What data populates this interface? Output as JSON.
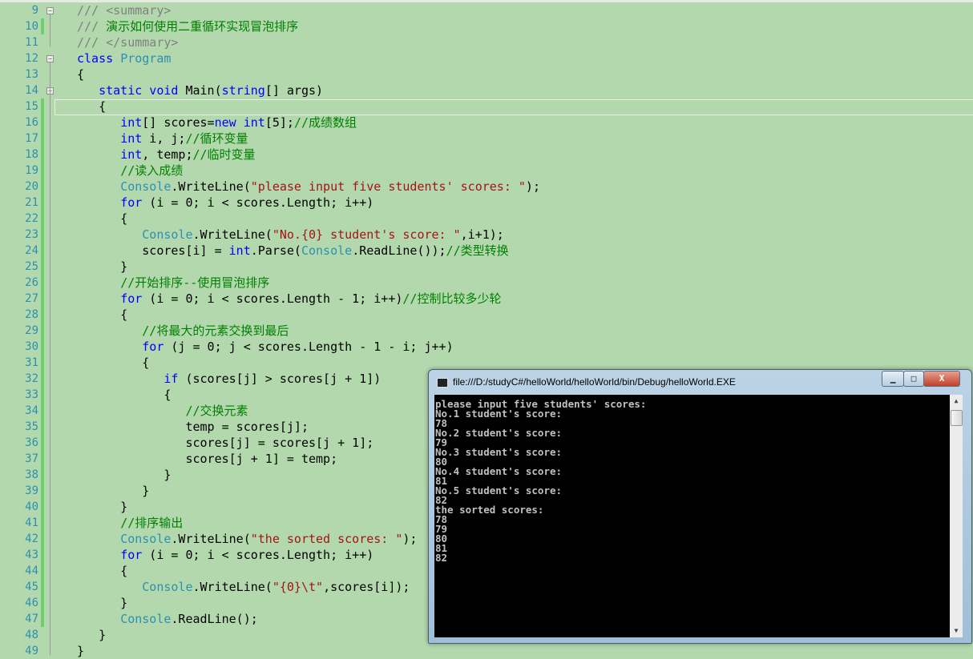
{
  "editor": {
    "lines": [
      {
        "n": "9",
        "t": [
          [
            "dc",
            "/// <summary>"
          ]
        ]
      },
      {
        "n": "10",
        "t": [
          [
            "dc",
            "/// "
          ],
          [
            "cm",
            "演示如何使用二重循环实现冒泡排序"
          ]
        ]
      },
      {
        "n": "11",
        "t": [
          [
            "dc",
            "/// </summary>"
          ]
        ]
      },
      {
        "n": "12",
        "t": [
          [
            "kw",
            "class "
          ],
          [
            "ty",
            "Program"
          ]
        ]
      },
      {
        "n": "13",
        "t": [
          [
            "",
            "{"
          ]
        ]
      },
      {
        "n": "14",
        "t": [
          [
            "",
            "   "
          ],
          [
            "kw",
            "static void "
          ],
          [
            "",
            "Main("
          ],
          [
            "kw",
            "string"
          ],
          [
            "",
            "[] args)"
          ]
        ]
      },
      {
        "n": "15",
        "t": [
          [
            "",
            "   {"
          ]
        ]
      },
      {
        "n": "16",
        "t": [
          [
            "",
            "      "
          ],
          [
            "kw",
            "int"
          ],
          [
            "",
            "[] scores="
          ],
          [
            "kw",
            "new int"
          ],
          [
            "",
            "[5];"
          ],
          [
            "cm",
            "//成绩数组"
          ]
        ]
      },
      {
        "n": "17",
        "t": [
          [
            "",
            "      "
          ],
          [
            "kw",
            "int"
          ],
          [
            "",
            " i, j;"
          ],
          [
            "cm",
            "//循环变量"
          ]
        ]
      },
      {
        "n": "18",
        "t": [
          [
            "",
            "      "
          ],
          [
            "kw",
            "int"
          ],
          [
            "",
            ", temp;"
          ],
          [
            "cm",
            "//临时变量"
          ]
        ]
      },
      {
        "n": "19",
        "t": [
          [
            "",
            "      "
          ],
          [
            "cm",
            "//读入成绩"
          ]
        ]
      },
      {
        "n": "20",
        "t": [
          [
            "",
            "      "
          ],
          [
            "ty",
            "Console"
          ],
          [
            "",
            ".WriteLine("
          ],
          [
            "st",
            "\"please input five students' scores: \""
          ],
          [
            "",
            ");"
          ]
        ]
      },
      {
        "n": "21",
        "t": [
          [
            "",
            "      "
          ],
          [
            "kw",
            "for"
          ],
          [
            "",
            " (i = 0; i < scores.Length; i++)"
          ]
        ]
      },
      {
        "n": "22",
        "t": [
          [
            "",
            "      {"
          ]
        ]
      },
      {
        "n": "23",
        "t": [
          [
            "",
            "         "
          ],
          [
            "ty",
            "Console"
          ],
          [
            "",
            ".WriteLine("
          ],
          [
            "st",
            "\"No.{0} student's score: \""
          ],
          [
            "",
            ",i+1);"
          ]
        ]
      },
      {
        "n": "24",
        "t": [
          [
            "",
            "         scores[i] = "
          ],
          [
            "kw",
            "int"
          ],
          [
            "",
            ".Parse("
          ],
          [
            "ty",
            "Console"
          ],
          [
            "",
            ".ReadLine());"
          ],
          [
            "cm",
            "//类型转换"
          ]
        ]
      },
      {
        "n": "25",
        "t": [
          [
            "",
            "      }"
          ]
        ]
      },
      {
        "n": "26",
        "t": [
          [
            "",
            "      "
          ],
          [
            "cm",
            "//开始排序--使用冒泡排序"
          ]
        ]
      },
      {
        "n": "27",
        "t": [
          [
            "",
            "      "
          ],
          [
            "kw",
            "for"
          ],
          [
            "",
            " (i = 0; i < scores.Length - 1; i++)"
          ],
          [
            "cm",
            "//控制比较多少轮"
          ]
        ]
      },
      {
        "n": "28",
        "t": [
          [
            "",
            "      {"
          ]
        ]
      },
      {
        "n": "29",
        "t": [
          [
            "",
            "         "
          ],
          [
            "cm",
            "//将最大的元素交换到最后"
          ]
        ]
      },
      {
        "n": "30",
        "t": [
          [
            "",
            "         "
          ],
          [
            "kw",
            "for"
          ],
          [
            "",
            " (j = 0; j < scores.Length - 1 - i; j++)"
          ]
        ]
      },
      {
        "n": "31",
        "t": [
          [
            "",
            "         {"
          ]
        ]
      },
      {
        "n": "32",
        "t": [
          [
            "",
            "            "
          ],
          [
            "kw",
            "if"
          ],
          [
            "",
            " (scores[j] > scores[j + 1])"
          ]
        ]
      },
      {
        "n": "33",
        "t": [
          [
            "",
            "            {"
          ]
        ]
      },
      {
        "n": "34",
        "t": [
          [
            "",
            "               "
          ],
          [
            "cm",
            "//交换元素"
          ]
        ]
      },
      {
        "n": "35",
        "t": [
          [
            "",
            "               temp = scores[j];"
          ]
        ]
      },
      {
        "n": "36",
        "t": [
          [
            "",
            "               scores[j] = scores[j + 1];"
          ]
        ]
      },
      {
        "n": "37",
        "t": [
          [
            "",
            "               scores[j + 1] = temp;"
          ]
        ]
      },
      {
        "n": "38",
        "t": [
          [
            "",
            "            }"
          ]
        ]
      },
      {
        "n": "39",
        "t": [
          [
            "",
            "         }"
          ]
        ]
      },
      {
        "n": "40",
        "t": [
          [
            "",
            "      }"
          ]
        ]
      },
      {
        "n": "41",
        "t": [
          [
            "",
            "      "
          ],
          [
            "cm",
            "//排序输出"
          ]
        ]
      },
      {
        "n": "42",
        "t": [
          [
            "",
            "      "
          ],
          [
            "ty",
            "Console"
          ],
          [
            "",
            ".WriteLine("
          ],
          [
            "st",
            "\"the sorted scores: \""
          ],
          [
            "",
            ");"
          ]
        ]
      },
      {
        "n": "43",
        "t": [
          [
            "",
            "      "
          ],
          [
            "kw",
            "for"
          ],
          [
            "",
            " (i = 0; i < scores.Length; i++)"
          ]
        ]
      },
      {
        "n": "44",
        "t": [
          [
            "",
            "      {"
          ]
        ]
      },
      {
        "n": "45",
        "t": [
          [
            "",
            "         "
          ],
          [
            "ty",
            "Console"
          ],
          [
            "",
            ".WriteLine("
          ],
          [
            "st",
            "\"{0}\\t\""
          ],
          [
            "",
            ",scores[i]);"
          ]
        ]
      },
      {
        "n": "46",
        "t": [
          [
            "",
            "      }"
          ]
        ]
      },
      {
        "n": "47",
        "t": [
          [
            "",
            "      "
          ],
          [
            "ty",
            "Console"
          ],
          [
            "",
            ".ReadLine();"
          ]
        ]
      },
      {
        "n": "48",
        "t": [
          [
            "",
            "   }"
          ]
        ]
      },
      {
        "n": "49",
        "t": [
          [
            "",
            "}"
          ]
        ]
      }
    ],
    "colors": {
      "background": "#b4d8ae",
      "keyword": "#0000ff",
      "type": "#2b91af",
      "string": "#a31515",
      "comment": "#008000"
    }
  },
  "console": {
    "title": "file:///D:/studyC#/helloWorld/helloWorld/bin/Debug/helloWorld.EXE",
    "buttons": {
      "minimize": "▁",
      "maximize": "□",
      "close": "X"
    },
    "lines": [
      "please input five students' scores:",
      "No.1 student's score:",
      "78",
      "No.2 student's score:",
      "79",
      "No.3 student's score:",
      "80",
      "No.4 student's score:",
      "81",
      "No.5 student's score:",
      "82",
      "the sorted scores:",
      "78",
      "79",
      "80",
      "81",
      "82"
    ]
  }
}
